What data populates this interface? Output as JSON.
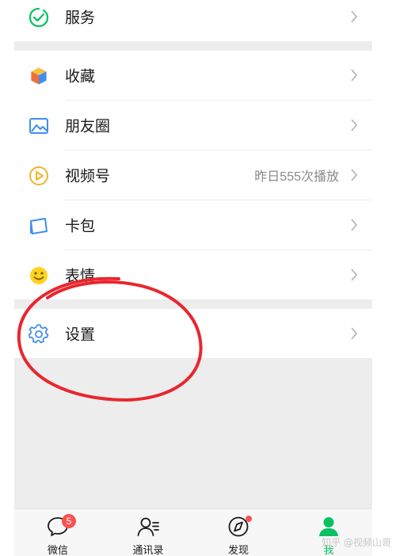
{
  "menu": {
    "services": {
      "label": "服务",
      "icon": "services-icon"
    },
    "favorites": {
      "label": "收藏",
      "icon": "favorites-cube-icon"
    },
    "moments": {
      "label": "朋友圈",
      "icon": "moments-image-icon"
    },
    "channels": {
      "label": "视频号",
      "extra": "昨日555次播放",
      "icon": "channels-play-icon"
    },
    "cards": {
      "label": "卡包",
      "icon": "card-wallet-icon"
    },
    "stickers": {
      "label": "表情",
      "icon": "smiley-icon"
    },
    "settings": {
      "label": "设置",
      "icon": "gear-icon"
    }
  },
  "tabbar": {
    "chats": {
      "label": "微信",
      "badge": "5",
      "icon": "chat-bubble-icon"
    },
    "contacts": {
      "label": "通讯录",
      "icon": "contacts-icon"
    },
    "discover": {
      "label": "发现",
      "icon": "compass-icon"
    },
    "me": {
      "label": "我",
      "icon": "person-icon",
      "active": true
    }
  },
  "watermark": "知乎 @视频山哥",
  "colors": {
    "accent_green": "#07c160",
    "badge_red": "#fa5151",
    "annotation_red": "#e8262f",
    "background_gray": "#ededed"
  }
}
